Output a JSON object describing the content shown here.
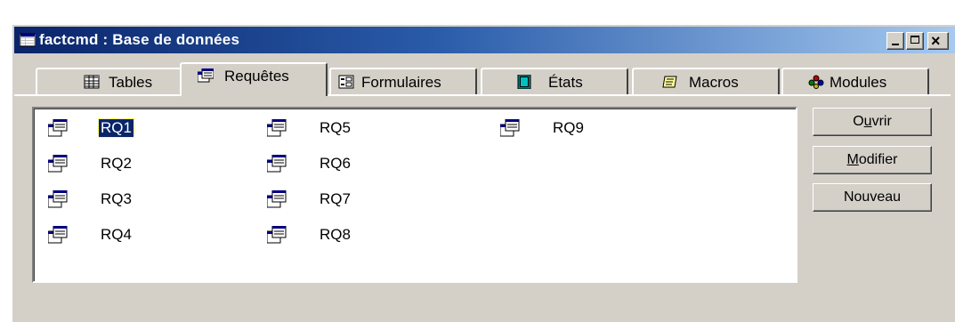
{
  "window": {
    "title": "factcmd : Base de données",
    "icon": "database-window-icon"
  },
  "caption_buttons": {
    "minimize": "minimize-icon",
    "maximize": "maximize-icon",
    "close": "close-icon",
    "close_glyph": "×"
  },
  "tabs": [
    {
      "label": "Tables",
      "icon": "table-icon",
      "active": false
    },
    {
      "label": "Requêtes",
      "icon": "query-icon",
      "active": true
    },
    {
      "label": "Formulaires",
      "icon": "form-icon",
      "active": false
    },
    {
      "label": "États",
      "icon": "report-icon",
      "active": false
    },
    {
      "label": "Macros",
      "icon": "macro-icon",
      "active": false
    },
    {
      "label": "Modules",
      "icon": "module-icon",
      "active": false
    }
  ],
  "queries": [
    {
      "label": "RQ1",
      "selected": true
    },
    {
      "label": "RQ2",
      "selected": false
    },
    {
      "label": "RQ3",
      "selected": false
    },
    {
      "label": "RQ4",
      "selected": false
    },
    {
      "label": "RQ5",
      "selected": false
    },
    {
      "label": "RQ6",
      "selected": false
    },
    {
      "label": "RQ7",
      "selected": false
    },
    {
      "label": "RQ8",
      "selected": false
    },
    {
      "label": "RQ9",
      "selected": false
    }
  ],
  "buttons": {
    "open": {
      "label": "Ouvrir",
      "accel": "u"
    },
    "modify": {
      "label": "Modifier",
      "accel": "M"
    },
    "new": {
      "label": "Nouveau",
      "accel": "y"
    }
  },
  "colors": {
    "titlebar_start": "#0a246a",
    "titlebar_end": "#a6caf0",
    "face": "#d4d0c8",
    "selection": "#0a246a"
  }
}
